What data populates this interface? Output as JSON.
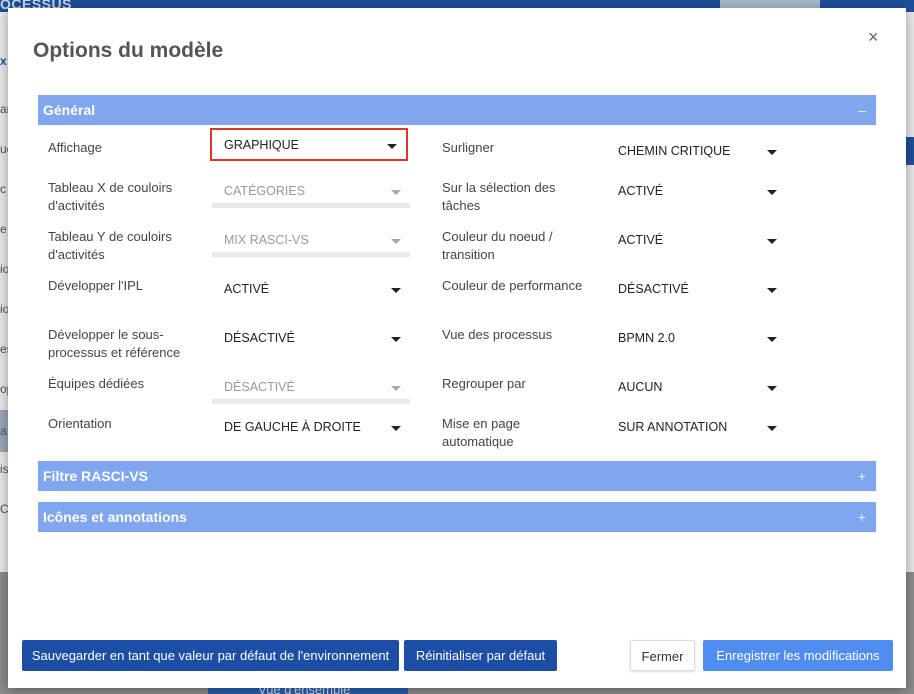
{
  "background": {
    "brand": "OCESSUS",
    "sidebar_letters": [
      "x",
      "ar",
      "uc",
      "c",
      "e",
      "io",
      "io",
      "es",
      "op",
      "a",
      "is",
      "C"
    ],
    "bottom_button": "Vue d'ensemble"
  },
  "modal": {
    "title": "Options du modèle",
    "close": "×"
  },
  "sections": {
    "general": {
      "label": "Général",
      "toggle": "–"
    },
    "filtre": {
      "label": "Filtre RASCI-VS",
      "toggle": "+"
    },
    "icones": {
      "label": "Icônes et annotations",
      "toggle": "+"
    }
  },
  "left_fields": [
    {
      "label": "Affichage",
      "value": "GRAPHIQUE",
      "state": "focused"
    },
    {
      "label": "Tableau X de couloirs d'activités",
      "value": "CATÉGORIES",
      "state": "disabled"
    },
    {
      "label": "Tableau Y de couloirs d'activités",
      "value": "MIX RASCI-VS",
      "state": "disabled"
    },
    {
      "label": "Développer l'IPL",
      "value": "ACTIVÉ",
      "state": "enabled"
    },
    {
      "label": "Développer le sous-processus et référence",
      "value": "DÉSACTIVÉ",
      "state": "enabled"
    },
    {
      "label": "Équipes dédiées",
      "value": "DÉSACTIVÉ",
      "state": "disabled"
    },
    {
      "label": "Orientation",
      "value": "DE GAUCHE À DROITE",
      "state": "enabled"
    }
  ],
  "right_fields": [
    {
      "label": "Surligner",
      "value": "CHEMIN CRITIQUE"
    },
    {
      "label": "Sur la sélection des tâches",
      "value": "ACTIVÉ"
    },
    {
      "label": "Couleur du noeud / transition",
      "value": "ACTIVÉ"
    },
    {
      "label": "Couleur de performance",
      "value": "DÉSACTIVÉ"
    },
    {
      "label": "Vue des processus",
      "value": "BPMN 2.0"
    },
    {
      "label": "Regrouper par",
      "value": "AUCUN"
    },
    {
      "label": "Mise en page automatique",
      "value": "SUR ANNOTATION"
    }
  ],
  "footer": {
    "save_default_env": "Sauvegarder en tant que valeur par défaut de l'environnement",
    "reset_default": "Réinitialiser par défaut",
    "close": "Fermer",
    "save_changes": "Enregistrer les modifications"
  }
}
